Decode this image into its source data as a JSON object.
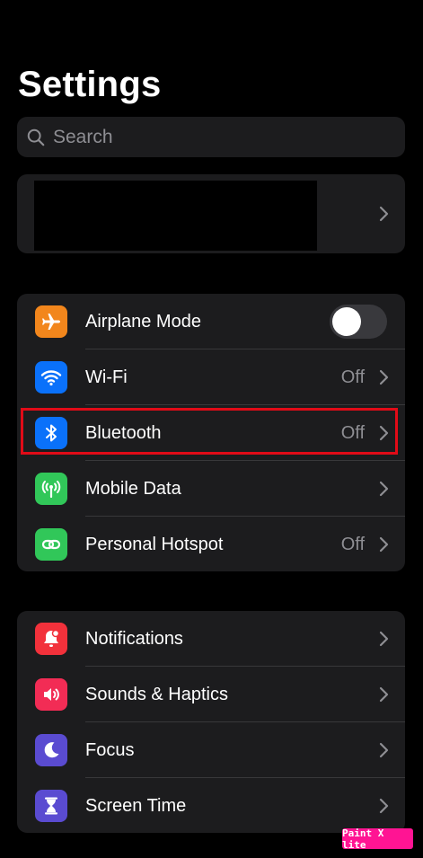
{
  "page": {
    "title": "Settings"
  },
  "search": {
    "placeholder": "Search",
    "icon": "search-icon"
  },
  "profile": {
    "redacted": true
  },
  "group_connectivity": {
    "rows": [
      {
        "label": "Airplane Mode",
        "icon": "airplane-icon",
        "icon_color": "#f2861c",
        "control": "toggle",
        "toggle_on": false
      },
      {
        "label": "Wi-Fi",
        "value": "Off",
        "icon": "wifi-icon",
        "icon_color": "#0a71fa"
      },
      {
        "label": "Bluetooth",
        "value": "Off",
        "icon": "bluetooth-icon",
        "icon_color": "#0a71fa",
        "highlighted": true
      },
      {
        "label": "Mobile Data",
        "value": "",
        "icon": "antenna-icon",
        "icon_color": "#31c759"
      },
      {
        "label": "Personal Hotspot",
        "value": "Off",
        "icon": "hotspot-icon",
        "icon_color": "#31c759"
      }
    ]
  },
  "group_notifications": {
    "rows": [
      {
        "label": "Notifications",
        "icon": "bell-icon",
        "icon_color": "#f2313b"
      },
      {
        "label": "Sounds & Haptics",
        "icon": "speaker-icon",
        "icon_color": "#f22c55"
      },
      {
        "label": "Focus",
        "icon": "moon-icon",
        "icon_color": "#5a4bd1"
      },
      {
        "label": "Screen Time",
        "icon": "hourglass-icon",
        "icon_color": "#5a4bd1"
      }
    ]
  },
  "colors": {
    "background": "#000000",
    "card": "#1c1c1e",
    "secondary_text": "#8e8e93",
    "highlight": "#e10b17",
    "watermark": "#ff1493"
  },
  "watermark": {
    "text": "Paint X lite"
  }
}
